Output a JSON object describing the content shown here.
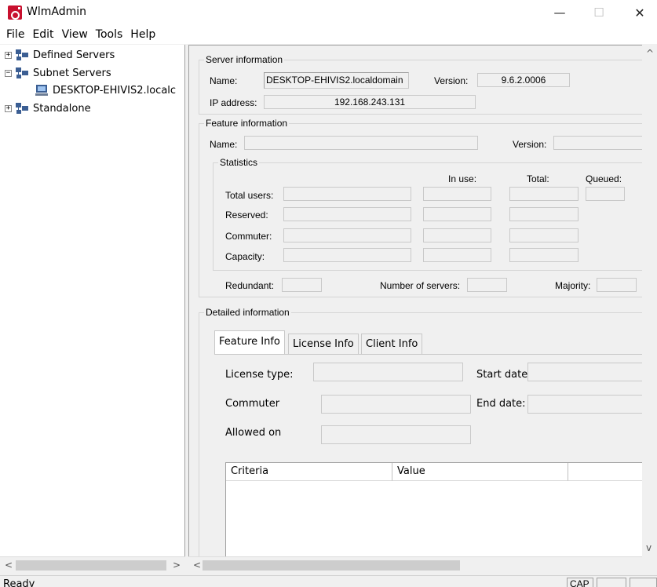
{
  "window": {
    "title": "WlmAdmin",
    "minimize_glyph": "—",
    "maximize_glyph": "☐",
    "close_glyph": "✕"
  },
  "menu": [
    "File",
    "Edit",
    "View",
    "Tools",
    "Help"
  ],
  "tree": {
    "defined_servers": "Defined Servers",
    "subnet_servers": "Subnet Servers",
    "subnet_child": "DESKTOP-EHIVIS2.localc",
    "standalone": "Standalone",
    "expand_glyph": "+",
    "collapse_glyph": "−"
  },
  "server_info": {
    "group_label": "Server information",
    "name_label": "Name:",
    "name_value": "DESKTOP-EHIVIS2.localdomain",
    "version_label": "Version:",
    "version_value": "9.6.2.0006",
    "ip_label": "IP address:",
    "ip_value": "192.168.243.131"
  },
  "feature_info": {
    "group_label": "Feature information",
    "name_label": "Name:",
    "version_label": "Version:",
    "statistics_label": "Statistics",
    "in_use_label": "In use:",
    "total_label": "Total:",
    "queued_label": "Queued:",
    "rows": [
      "Total users:",
      "Reserved:",
      "Commuter:",
      "Capacity:"
    ],
    "redundant_label": "Redundant:",
    "num_servers_label": "Number of servers:",
    "majority_label": "Majority:"
  },
  "detailed_info": {
    "group_label": "Detailed information",
    "tabs": [
      "Feature Info",
      "License Info",
      "Client Info"
    ],
    "license_type_label": "License type:",
    "start_date_label": "Start date",
    "commuter_label": "Commuter",
    "end_date_label": "End date:",
    "allowed_on_label": "Allowed on",
    "columns": [
      "Criteria",
      "Value"
    ]
  },
  "scroll": {
    "left_arrow": "<",
    "right_arrow": ">",
    "up_arrow": "^",
    "down_arrow": "v"
  },
  "status": {
    "text": "Ready",
    "cap": "CAP"
  }
}
